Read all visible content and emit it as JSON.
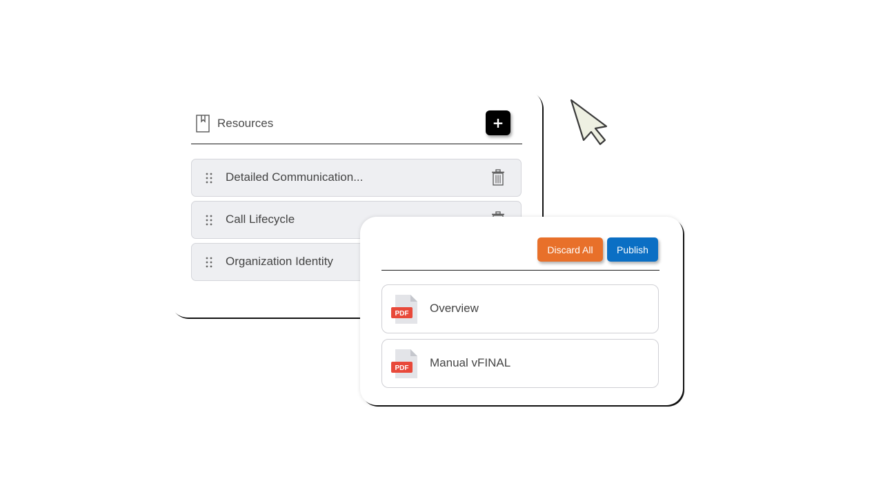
{
  "resources_panel": {
    "title": "Resources",
    "add_label": "+",
    "items": [
      {
        "label": "Detailed Communication..."
      },
      {
        "label": "Call Lifecycle"
      },
      {
        "label": "Organization Identity"
      }
    ]
  },
  "publish_panel": {
    "discard_label": "Discard All",
    "publish_label": "Publish",
    "files": [
      {
        "label": "Overview",
        "icon": "pdf-file-icon",
        "badge": "PDF"
      },
      {
        "label": "Manual vFINAL",
        "icon": "pdf-file-icon",
        "badge": "PDF"
      }
    ]
  },
  "colors": {
    "discard": "#e8702a",
    "publish": "#0b6fc4",
    "add_button": "#000000",
    "list_item_bg": "#eeeff2",
    "pdf_badge": "#e8493a"
  }
}
